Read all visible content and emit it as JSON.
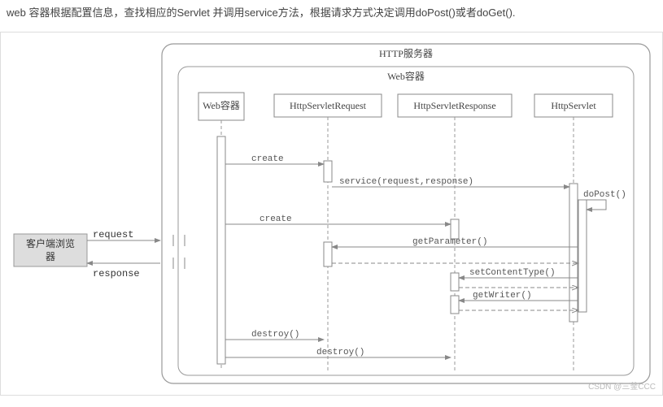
{
  "caption": "web 容器根据配置信息，查找相应的Servlet 并调用service方法，根据请求方式决定调用doPost()或者doGet().",
  "watermark": "CSDN @三釜CCC",
  "diagram": {
    "outer_title": "HTTP服务器",
    "inner_title": "Web容器",
    "client_label_line1": "客户端浏览",
    "client_label_line2": "器",
    "request_label": "request",
    "response_label": "response",
    "participants": {
      "web_container": "Web容器",
      "http_request": "HttpServletRequest",
      "http_response": "HttpServletResponse",
      "http_servlet": "HttpServlet"
    },
    "messages": {
      "create1": "create",
      "service": "service(request,response)",
      "dopost": "doPost()",
      "create2": "create",
      "getparam": "getParameter()",
      "setct": "setContentType()",
      "getwriter": "getWriter()",
      "destroy1": "destroy()",
      "destroy2": "destroy()"
    }
  }
}
